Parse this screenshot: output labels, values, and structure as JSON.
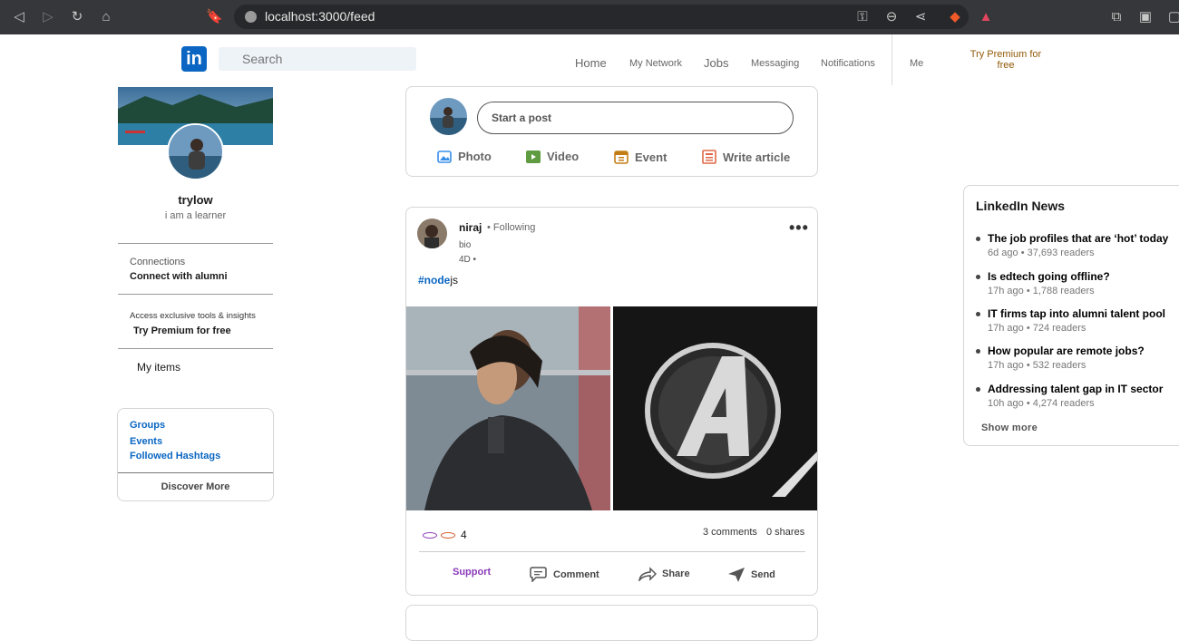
{
  "browser": {
    "url": "localhost:3000/feed"
  },
  "header": {
    "logo": "in",
    "search_placeholder": "Search",
    "nav": {
      "home": "Home",
      "network": "My Network",
      "jobs": "Jobs",
      "messaging": "Messaging",
      "notifications": "Notifications",
      "me": "Me",
      "premium": "Try Premium for free"
    }
  },
  "profile": {
    "name": "trylow",
    "bio": "i am a learner",
    "connections_label": "Connections",
    "connections_action": "Connect with alumni",
    "premium_note": "Access exclusive tools & insights",
    "premium_action": "Try Premium for free",
    "my_items": "My items"
  },
  "side_links": {
    "groups": "Groups",
    "events": "Events",
    "hashtags": "Followed Hashtags",
    "discover": "Discover More"
  },
  "composer": {
    "placeholder": "Start a post",
    "photo": "Photo",
    "video": "Video",
    "event": "Event",
    "article": "Write article"
  },
  "post": {
    "author": "niraj",
    "following": "• Following",
    "bio": "bio",
    "time": "4D •",
    "hashtag": "#node",
    "text_rest": "js",
    "reactions_count": "4",
    "comments": "3 comments",
    "shares": "0 shares",
    "actions": {
      "support": "Support",
      "comment": "Comment",
      "share": "Share",
      "send": "Send"
    }
  },
  "news": {
    "title": "LinkedIn News",
    "items": [
      {
        "headline": "The job profiles that are ‘hot’ today",
        "meta": "6d ago • 37,693 readers"
      },
      {
        "headline": "Is edtech going offline?",
        "meta": "17h ago • 1,788 readers"
      },
      {
        "headline": "IT firms tap into alumni talent pool",
        "meta": "17h ago • 724 readers"
      },
      {
        "headline": "How popular are remote jobs?",
        "meta": "17h ago • 532 readers"
      },
      {
        "headline": "Addressing talent gap in IT sector",
        "meta": "10h ago • 4,274 readers"
      }
    ],
    "show_more": "Show more"
  },
  "colors": {
    "brand": "#0a66c2",
    "support": "#8a3ab9",
    "premium_link": "#915907"
  }
}
